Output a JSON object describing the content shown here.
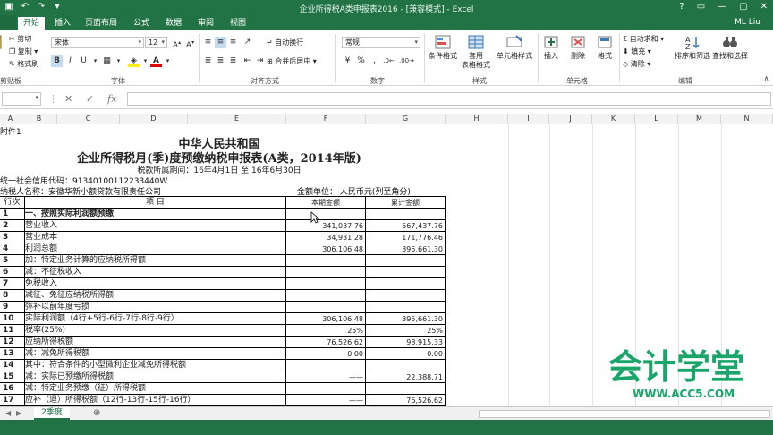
{
  "titlebar": {
    "title": "企业所得税A类申报表2016 - [兼容模式] - Excel",
    "user": "ML Liu"
  },
  "tabs": [
    "开始",
    "插入",
    "页面布局",
    "公式",
    "数据",
    "审阅",
    "视图"
  ],
  "ribbon": {
    "clipboard": {
      "cut": "剪切",
      "copy": "复制",
      "painter": "格式刷",
      "label": "剪贴板"
    },
    "font": {
      "name": "宋体",
      "size": "12",
      "label": "字体",
      "bold": "B",
      "italic": "I",
      "underline": "U"
    },
    "align": {
      "wrap": "自动换行",
      "merge": "合并后居中",
      "label": "对齐方式"
    },
    "number": {
      "format": "常规",
      "label": "数字"
    },
    "styles": {
      "cond": "条件格式",
      "table": "套用\n表格格式",
      "cell": "单元格样式",
      "label": "样式"
    },
    "cells": {
      "insert": "插入",
      "delete": "删除",
      "format": "格式",
      "label": "单元格"
    },
    "editing": {
      "autosum": "自动求和",
      "fill": "填充",
      "clear": "清除",
      "sort": "排序和筛选",
      "find": "查找和选择",
      "label": "编辑"
    }
  },
  "formula_bar": {
    "fx": "fx"
  },
  "columns": [
    "A",
    "B",
    "C",
    "D",
    "E",
    "F",
    "G",
    "H",
    "I",
    "J",
    "K",
    "L",
    "M",
    "N"
  ],
  "sheet": {
    "attach": "附件1",
    "title1": "中华人民共和国",
    "title2": "企业所得税月(季)度预缴纳税申报表(A类，2014年版)",
    "period": "税款所属期间：16年4月1日 至 16年6月30日",
    "credit": "统一社会信用代码：91340100112233440W",
    "taxpayer": "纳税人名称：安徽华新小额贷款有限责任公司",
    "unit": "金额单位：  人民币元(列至角分)"
  },
  "table": {
    "headers": [
      "行次",
      "项      目",
      "本期金额",
      "累计金额"
    ],
    "rows": [
      {
        "no": "1",
        "item": "一、按照实际利润额预缴",
        "cur": "",
        "acc": "",
        "bold": true
      },
      {
        "no": "2",
        "item": "营业收入",
        "cur": "341,037.76",
        "acc": "567,437.76"
      },
      {
        "no": "3",
        "item": "营业成本",
        "cur": "34,931.28",
        "acc": "171,776.46"
      },
      {
        "no": "4",
        "item": "利润总额",
        "cur": "306,106.48",
        "acc": "395,661.30"
      },
      {
        "no": "5",
        "item": "加：特定业务计算的应纳税所得额",
        "cur": "",
        "acc": ""
      },
      {
        "no": "6",
        "item": "减：不征税收入",
        "cur": "",
        "acc": ""
      },
      {
        "no": "7",
        "item": "      免税收入",
        "cur": "",
        "acc": ""
      },
      {
        "no": "8",
        "item": "      减征、免征应纳税所得额",
        "cur": "",
        "acc": ""
      },
      {
        "no": "9",
        "item": "      弥补以前年度亏损",
        "cur": "",
        "acc": ""
      },
      {
        "no": "10",
        "item": "实际利润额（4行+5行-6行-7行-8行-9行）",
        "cur": "306,106.48",
        "acc": "395,661.30"
      },
      {
        "no": "11",
        "item": "税率(25%)",
        "cur": "25%",
        "acc": "25%"
      },
      {
        "no": "12",
        "item": "应纳所得税额",
        "cur": "76,526.62",
        "acc": "98,915.33"
      },
      {
        "no": "13",
        "item": "减：减免所得税额",
        "cur": "0.00",
        "acc": "0.00"
      },
      {
        "no": "14",
        "item": "      其中：符合条件的小型微利企业减免所得税额",
        "cur": "",
        "acc": ""
      },
      {
        "no": "15",
        "item": "减：实际已预缴所得税额",
        "cur": "——",
        "acc": "22,388.71"
      },
      {
        "no": "16",
        "item": "减：特定业务预缴（征）所得税额",
        "cur": "",
        "acc": ""
      },
      {
        "no": "17",
        "item": "应补（退）所得税额（12行-13行-15行-16行）",
        "cur": "——",
        "acc": "76,526.62"
      }
    ]
  },
  "sheet_tab": "2季度",
  "watermark": {
    "text": "会计学堂",
    "url": "WWW.ACC5.COM"
  },
  "colors": {
    "accent": "#217346",
    "logo": "#1aa56b"
  }
}
